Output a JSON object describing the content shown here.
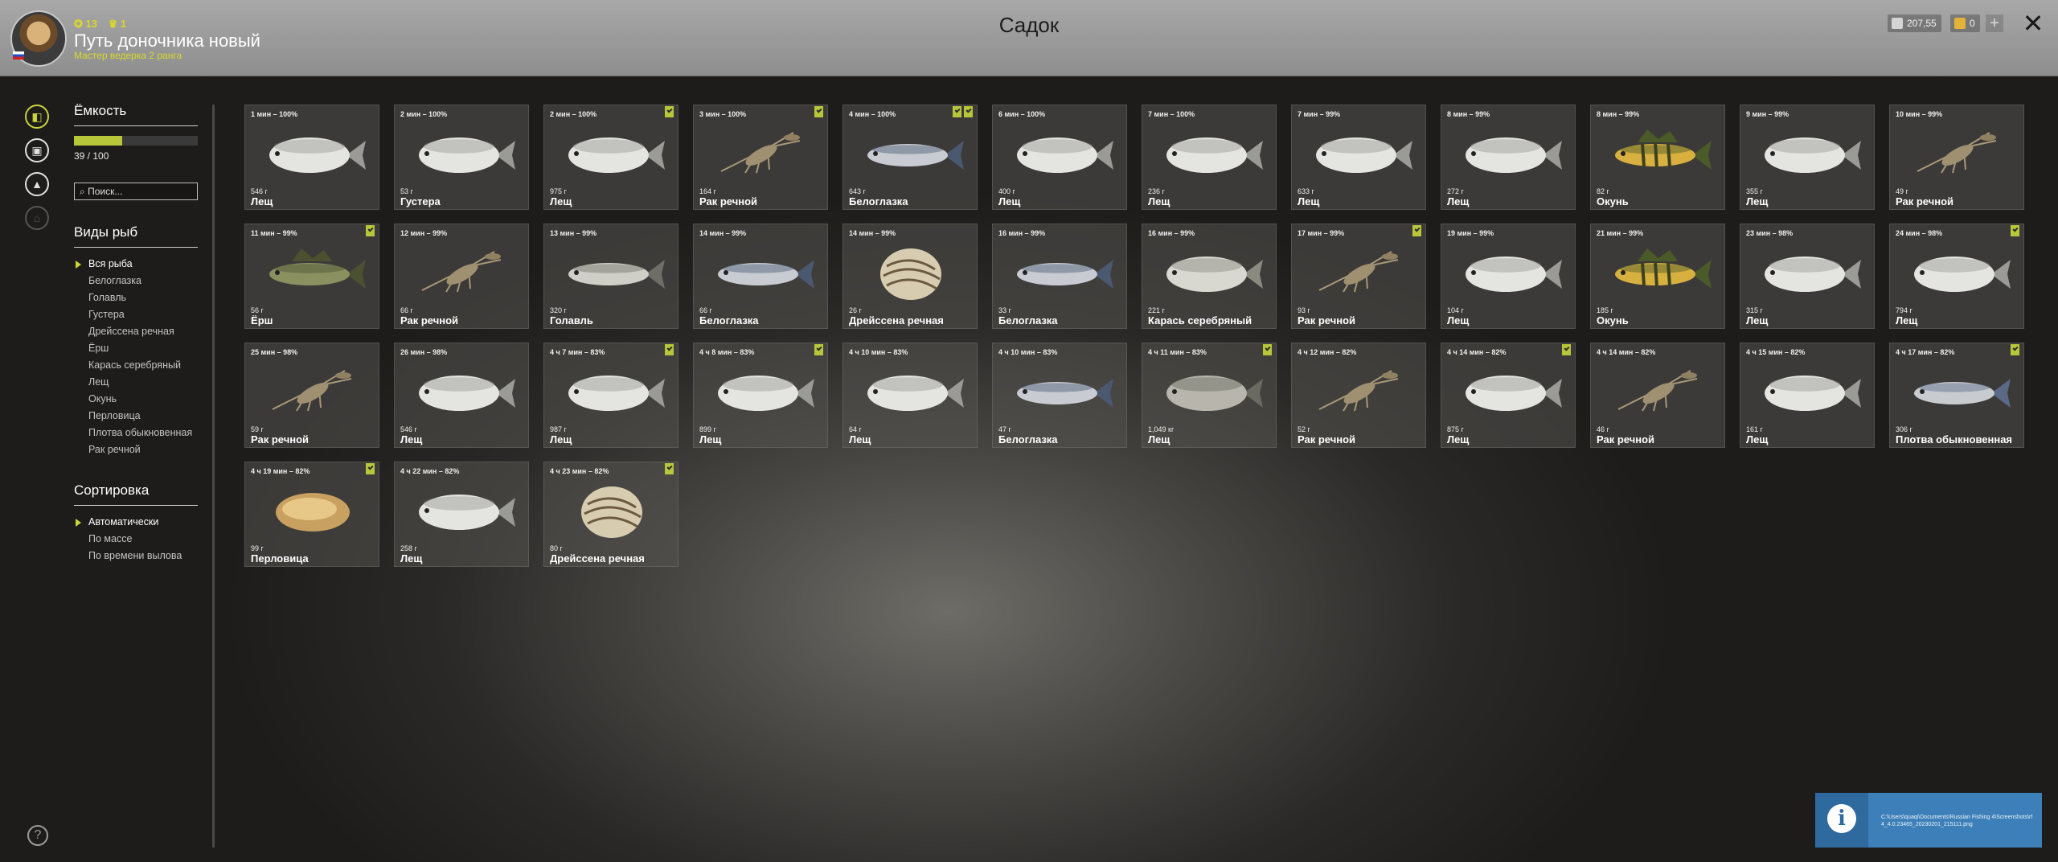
{
  "header": {
    "title": "Садок",
    "player_name": "Путь доночника новый",
    "player_rank": "Мастер ведерка 2 ранга",
    "stat_level": "13",
    "stat_second": "1",
    "currency_silver": "207,55",
    "currency_gold": "0",
    "add_label": "+",
    "close_label": "✕"
  },
  "capacity": {
    "title": "Ёмкость",
    "text": "39 / 100",
    "fill_fraction": 0.39
  },
  "search": {
    "placeholder": "Поиск..."
  },
  "species": {
    "title": "Виды рыб",
    "items": [
      "Вся рыба",
      "Белоглазка",
      "Голавль",
      "Густера",
      "Дрейссена речная",
      "Ёрш",
      "Карась серебряный",
      "Лещ",
      "Окунь",
      "Перловица",
      "Плотва обыкновенная",
      "Рак речной"
    ],
    "selected": 0
  },
  "sorting": {
    "title": "Сортировка",
    "items": [
      "Автоматически",
      "По массе",
      "По времени вылова"
    ],
    "selected": 0
  },
  "colors": {
    "accent": "#b8c63a",
    "header_bg": "#9e9e9e",
    "notification": "#3d7fb8"
  },
  "catch": [
    {
      "time": "1 мин – 100%",
      "weight": "546 г",
      "name": "Лещ",
      "type": "bream",
      "marks": 0
    },
    {
      "time": "2 мин – 100%",
      "weight": "53 г",
      "name": "Густера",
      "type": "bream",
      "marks": 0
    },
    {
      "time": "2 мин – 100%",
      "weight": "975 г",
      "name": "Лещ",
      "type": "bream",
      "marks": 1
    },
    {
      "time": "3 мин – 100%",
      "weight": "164 г",
      "name": "Рак речной",
      "type": "crayfish",
      "marks": 1
    },
    {
      "time": "4 мин – 100%",
      "weight": "643 г",
      "name": "Белоглазка",
      "type": "bleak",
      "marks": 2
    },
    {
      "time": "6 мин – 100%",
      "weight": "400 г",
      "name": "Лещ",
      "type": "bream",
      "marks": 0
    },
    {
      "time": "7 мин – 100%",
      "weight": "236 г",
      "name": "Лещ",
      "type": "bream",
      "marks": 0
    },
    {
      "time": "7 мин – 99%",
      "weight": "633 г",
      "name": "Лещ",
      "type": "bream",
      "marks": 0
    },
    {
      "time": "8 мин – 99%",
      "weight": "272 г",
      "name": "Лещ",
      "type": "bream",
      "marks": 0
    },
    {
      "time": "8 мин – 99%",
      "weight": "82 г",
      "name": "Окунь",
      "type": "perch",
      "marks": 0
    },
    {
      "time": "9 мин – 99%",
      "weight": "355 г",
      "name": "Лещ",
      "type": "bream",
      "marks": 0
    },
    {
      "time": "10 мин – 99%",
      "weight": "49 г",
      "name": "Рак речной",
      "type": "crayfish",
      "marks": 0
    },
    {
      "time": "11 мин – 99%",
      "weight": "56 г",
      "name": "Ёрш",
      "type": "ruffe",
      "marks": 1
    },
    {
      "time": "12 мин – 99%",
      "weight": "66 г",
      "name": "Рак речной",
      "type": "crayfish",
      "marks": 0
    },
    {
      "time": "13 мин – 99%",
      "weight": "320 г",
      "name": "Голавль",
      "type": "chub",
      "marks": 0
    },
    {
      "time": "14 мин – 99%",
      "weight": "66 г",
      "name": "Белоглазка",
      "type": "bleak",
      "marks": 0
    },
    {
      "time": "14 мин – 99%",
      "weight": "26 г",
      "name": "Дрейссена речная",
      "type": "mussel",
      "marks": 0
    },
    {
      "time": "16 мин – 99%",
      "weight": "33 г",
      "name": "Белоглазка",
      "type": "bleak",
      "marks": 0
    },
    {
      "time": "16 мин – 99%",
      "weight": "221 г",
      "name": "Карась серебряный",
      "type": "carp",
      "marks": 0
    },
    {
      "time": "17 мин – 99%",
      "weight": "93 г",
      "name": "Рак речной",
      "type": "crayfish",
      "marks": 1
    },
    {
      "time": "19 мин – 99%",
      "weight": "104 г",
      "name": "Лещ",
      "type": "bream",
      "marks": 0
    },
    {
      "time": "21 мин – 99%",
      "weight": "185 г",
      "name": "Окунь",
      "type": "perch",
      "marks": 0
    },
    {
      "time": "23 мин – 98%",
      "weight": "315 г",
      "name": "Лещ",
      "type": "bream",
      "marks": 0
    },
    {
      "time": "24 мин – 98%",
      "weight": "794 г",
      "name": "Лещ",
      "type": "bream",
      "marks": 1
    },
    {
      "time": "25 мин – 98%",
      "weight": "59 г",
      "name": "Рак речной",
      "type": "crayfish",
      "marks": 0
    },
    {
      "time": "26 мин – 98%",
      "weight": "546 г",
      "name": "Лещ",
      "type": "bream",
      "marks": 0
    },
    {
      "time": "4 ч 7 мин – 83%",
      "weight": "987 г",
      "name": "Лещ",
      "type": "bream",
      "marks": 1
    },
    {
      "time": "4 ч 8 мин – 83%",
      "weight": "899 г",
      "name": "Лещ",
      "type": "bream",
      "marks": 1
    },
    {
      "time": "4 ч 10 мин – 83%",
      "weight": "64 г",
      "name": "Лещ",
      "type": "bream",
      "marks": 0
    },
    {
      "time": "4 ч 10 мин – 83%",
      "weight": "47 г",
      "name": "Белоглазка",
      "type": "bleak",
      "marks": 0
    },
    {
      "time": "4 ч 11 мин – 83%",
      "weight": "1,049 кг",
      "name": "Лещ",
      "type": "breamdark",
      "marks": 1
    },
    {
      "time": "4 ч 12 мин – 82%",
      "weight": "52 г",
      "name": "Рак речной",
      "type": "crayfish",
      "marks": 0
    },
    {
      "time": "4 ч 14 мин – 82%",
      "weight": "875 г",
      "name": "Лещ",
      "type": "bream",
      "marks": 1
    },
    {
      "time": "4 ч 14 мин – 82%",
      "weight": "46 г",
      "name": "Рак речной",
      "type": "crayfish",
      "marks": 0
    },
    {
      "time": "4 ч 15 мин – 82%",
      "weight": "161 г",
      "name": "Лещ",
      "type": "bream",
      "marks": 0
    },
    {
      "time": "4 ч 17 мин – 82%",
      "weight": "306 г",
      "name": "Плотва обыкновенная",
      "type": "roach",
      "marks": 1
    },
    {
      "time": "4 ч 19 мин – 82%",
      "weight": "99 г",
      "name": "Перловица",
      "type": "pearl",
      "marks": 1
    },
    {
      "time": "4 ч 22 мин – 82%",
      "weight": "258 г",
      "name": "Лещ",
      "type": "bream",
      "marks": 0
    },
    {
      "time": "4 ч 23 мин – 82%",
      "weight": "80 г",
      "name": "Дрейссена речная",
      "type": "mussel",
      "marks": 1
    }
  ],
  "notification": {
    "icon": "info-icon",
    "text": "C:\\Users\\quaqi\\Documents\\Russian Fishing 4\\Screenshots\\rf4_4.0.23465_20230201_215111.png"
  }
}
